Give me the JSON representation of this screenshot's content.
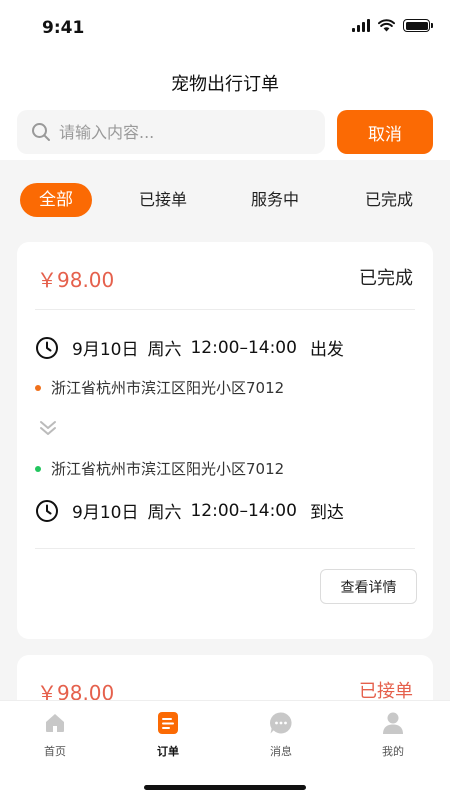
{
  "status_bar": {
    "time": "9:41"
  },
  "header": {
    "title": "宠物出行订单",
    "search_placeholder": "请输入内容...",
    "cancel_label": "取消"
  },
  "tabs": [
    {
      "label": "全部",
      "active": true
    },
    {
      "label": "已接单",
      "active": false
    },
    {
      "label": "服务中",
      "active": false
    },
    {
      "label": "已完成",
      "active": false
    }
  ],
  "orders": [
    {
      "price": "￥98.00",
      "status": "已完成",
      "depart": {
        "date": "9月10日",
        "weekday": "周六",
        "time": "12:00–14:00",
        "label": "出发"
      },
      "origin": "浙江省杭州市滨江区阳光小区7012",
      "destination": "浙江省杭州市滨江区阳光小区7012",
      "arrive": {
        "date": "9月10日",
        "weekday": "周六",
        "time": "12:00–14:00",
        "label": "到达"
      },
      "detail_label": "查看详情"
    },
    {
      "price": "￥98.00",
      "status": "已接单"
    }
  ],
  "tabbar": [
    {
      "label": "首页",
      "icon": "home-icon",
      "active": false
    },
    {
      "label": "订单",
      "icon": "order-icon",
      "active": true
    },
    {
      "label": "消息",
      "icon": "message-icon",
      "active": false
    },
    {
      "label": "我的",
      "icon": "profile-icon",
      "active": false
    }
  ],
  "colors": {
    "accent": "#fb6a04",
    "price": "#e5604c",
    "origin_dot": "#f0701a",
    "destination_dot": "#22c55e"
  }
}
